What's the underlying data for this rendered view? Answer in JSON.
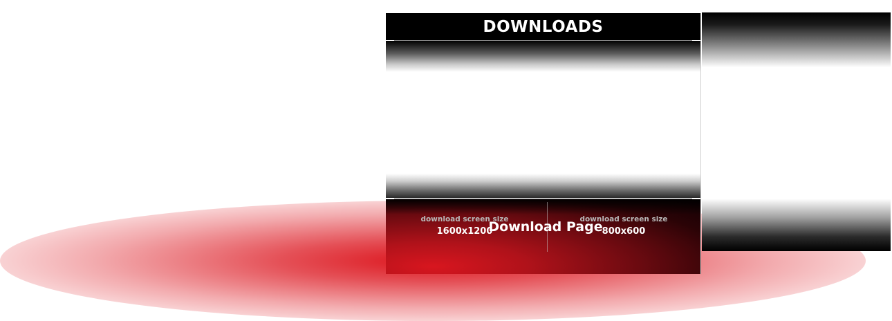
{
  "panel": {
    "title": "DOWNLOADS"
  },
  "downloads": {
    "options": [
      {
        "caption": "download screen size",
        "size": "1600x1200"
      },
      {
        "caption": "download screen size",
        "size": "800x600"
      }
    ],
    "page_link_label": "Download Page"
  },
  "colors": {
    "header_bg": "#000000",
    "accent_red": "#dc141c",
    "text_primary": "#ffffff",
    "text_muted": "#b9b9b9"
  }
}
